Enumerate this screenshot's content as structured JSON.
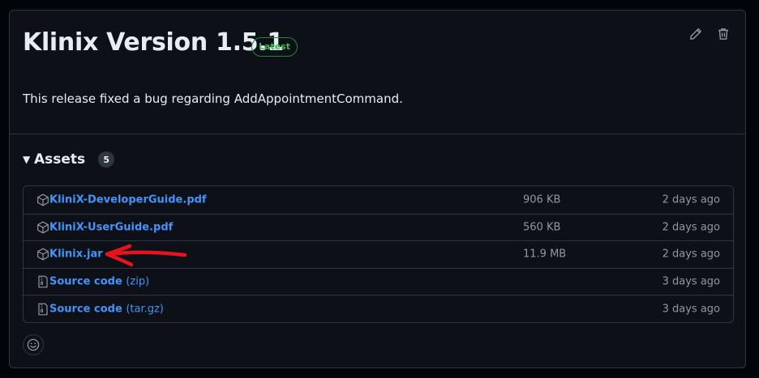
{
  "release": {
    "title": "Klinix Version 1.5.1",
    "badge": "Latest",
    "description": "This release fixed a bug regarding AddAppointmentCommand."
  },
  "toolbar": {
    "edit_icon": "pencil-icon",
    "delete_icon": "trash-icon"
  },
  "assets": {
    "label": "Assets",
    "count": "5",
    "items": [
      {
        "name": "KliniX-DeveloperGuide.pdf",
        "suffix": "",
        "size": "906 KB",
        "date": "2 days ago",
        "icon": "package-icon"
      },
      {
        "name": "KliniX-UserGuide.pdf",
        "suffix": "",
        "size": "560 KB",
        "date": "2 days ago",
        "icon": "package-icon"
      },
      {
        "name": "Klinix.jar",
        "suffix": "",
        "size": "11.9 MB",
        "date": "2 days ago",
        "icon": "package-icon"
      },
      {
        "name": "Source code",
        "suffix": "(zip)",
        "size": "",
        "date": "3 days ago",
        "icon": "file-zip-icon"
      },
      {
        "name": "Source code",
        "suffix": "(tar.gz)",
        "size": "",
        "date": "3 days ago",
        "icon": "file-zip-icon"
      }
    ]
  },
  "colors": {
    "accent_link": "#4493f8",
    "badge_green": "#3fb950",
    "annotation_red": "#e5141b"
  }
}
